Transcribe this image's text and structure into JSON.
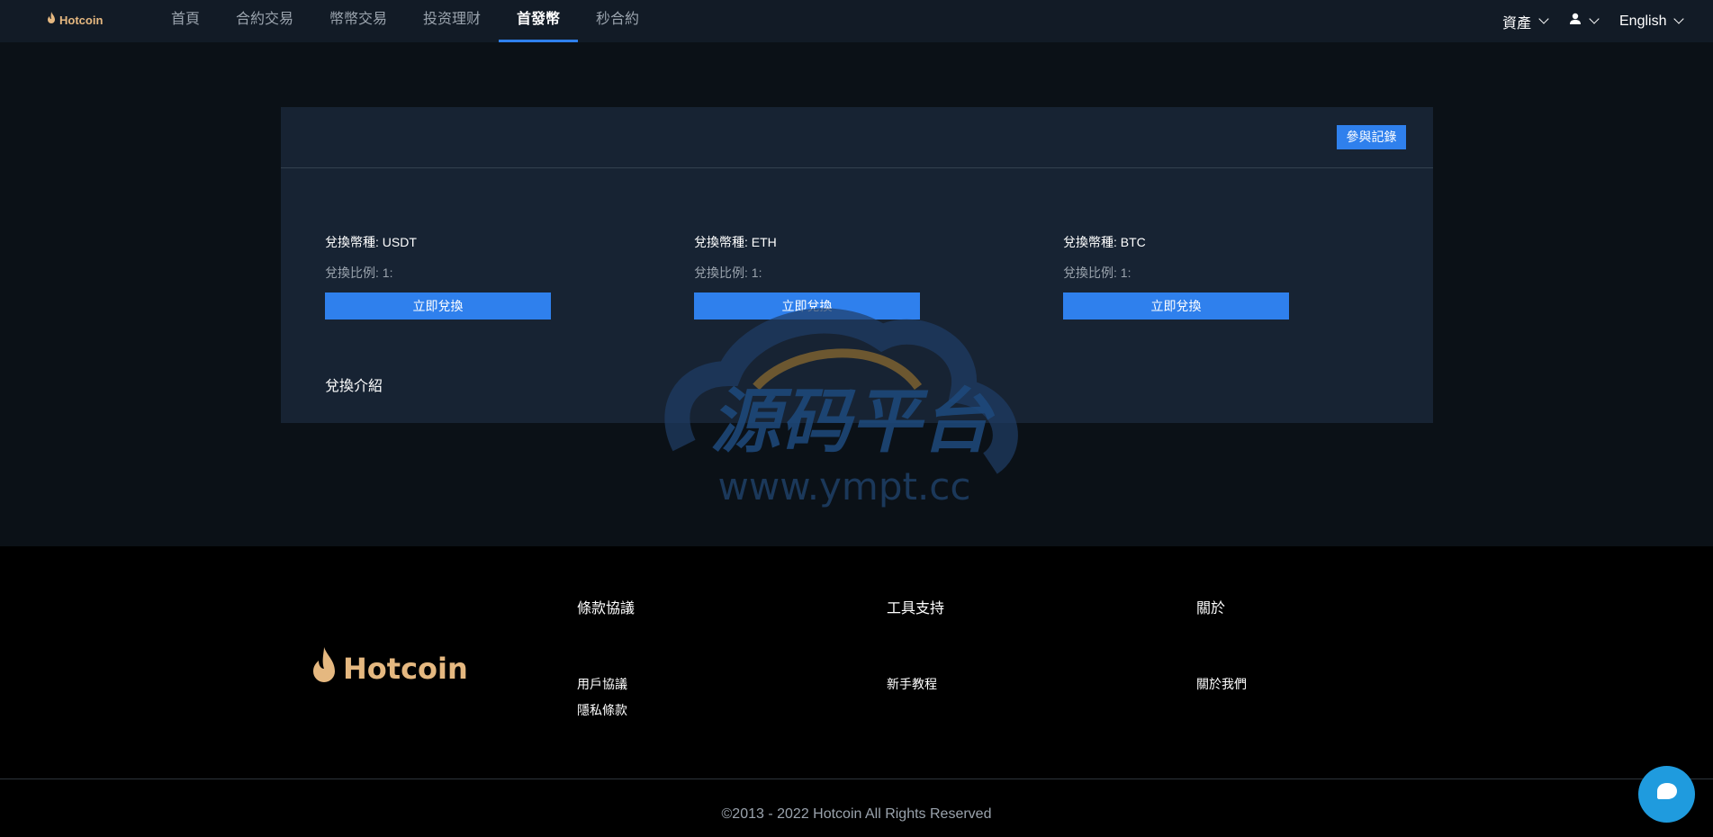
{
  "nav": {
    "logo_text": "Hotcoin",
    "items": [
      {
        "label": "首頁"
      },
      {
        "label": "合約交易"
      },
      {
        "label": "幣幣交易"
      },
      {
        "label": "投资理财"
      },
      {
        "label": "首發幣"
      },
      {
        "label": "秒合約"
      }
    ],
    "active_index": 4,
    "assets_label": "資產",
    "language_label": "English",
    "accent_color": "#2f80ed"
  },
  "panel": {
    "record_button_label": "參與記錄",
    "coins": [
      {
        "currency_label": "兌換幣種:",
        "currency": "USDT",
        "ratio_label": "兌換比例:",
        "ratio": "1:",
        "button_label": "立即兌換"
      },
      {
        "currency_label": "兌換幣種:",
        "currency": "ETH",
        "ratio_label": "兌換比例:",
        "ratio": "1:",
        "button_label": "立即兌換"
      },
      {
        "currency_label": "兌換幣種:",
        "currency": "BTC",
        "ratio_label": "兌換比例:",
        "ratio": "1:",
        "button_label": "立即兌換"
      }
    ],
    "intro_title": "兌換介紹"
  },
  "watermark": {
    "title": "源码平台",
    "url": "www.ympt.cc"
  },
  "footer": {
    "logo_text": "Hotcoin",
    "columns": [
      {
        "title": "條款協議",
        "links": [
          "用戶協議",
          "隱私條款"
        ]
      },
      {
        "title": "工具支持",
        "links": [
          "新手教程"
        ]
      },
      {
        "title": "關於",
        "links": [
          "關於我們"
        ]
      }
    ],
    "copyright": "©2013 - 2022 Hotcoin All Rights Reserved"
  },
  "icons": {
    "flame": "flame-icon",
    "user": "user-icon",
    "chat": "chat-icon",
    "chevron": "chevron-down-icon"
  }
}
